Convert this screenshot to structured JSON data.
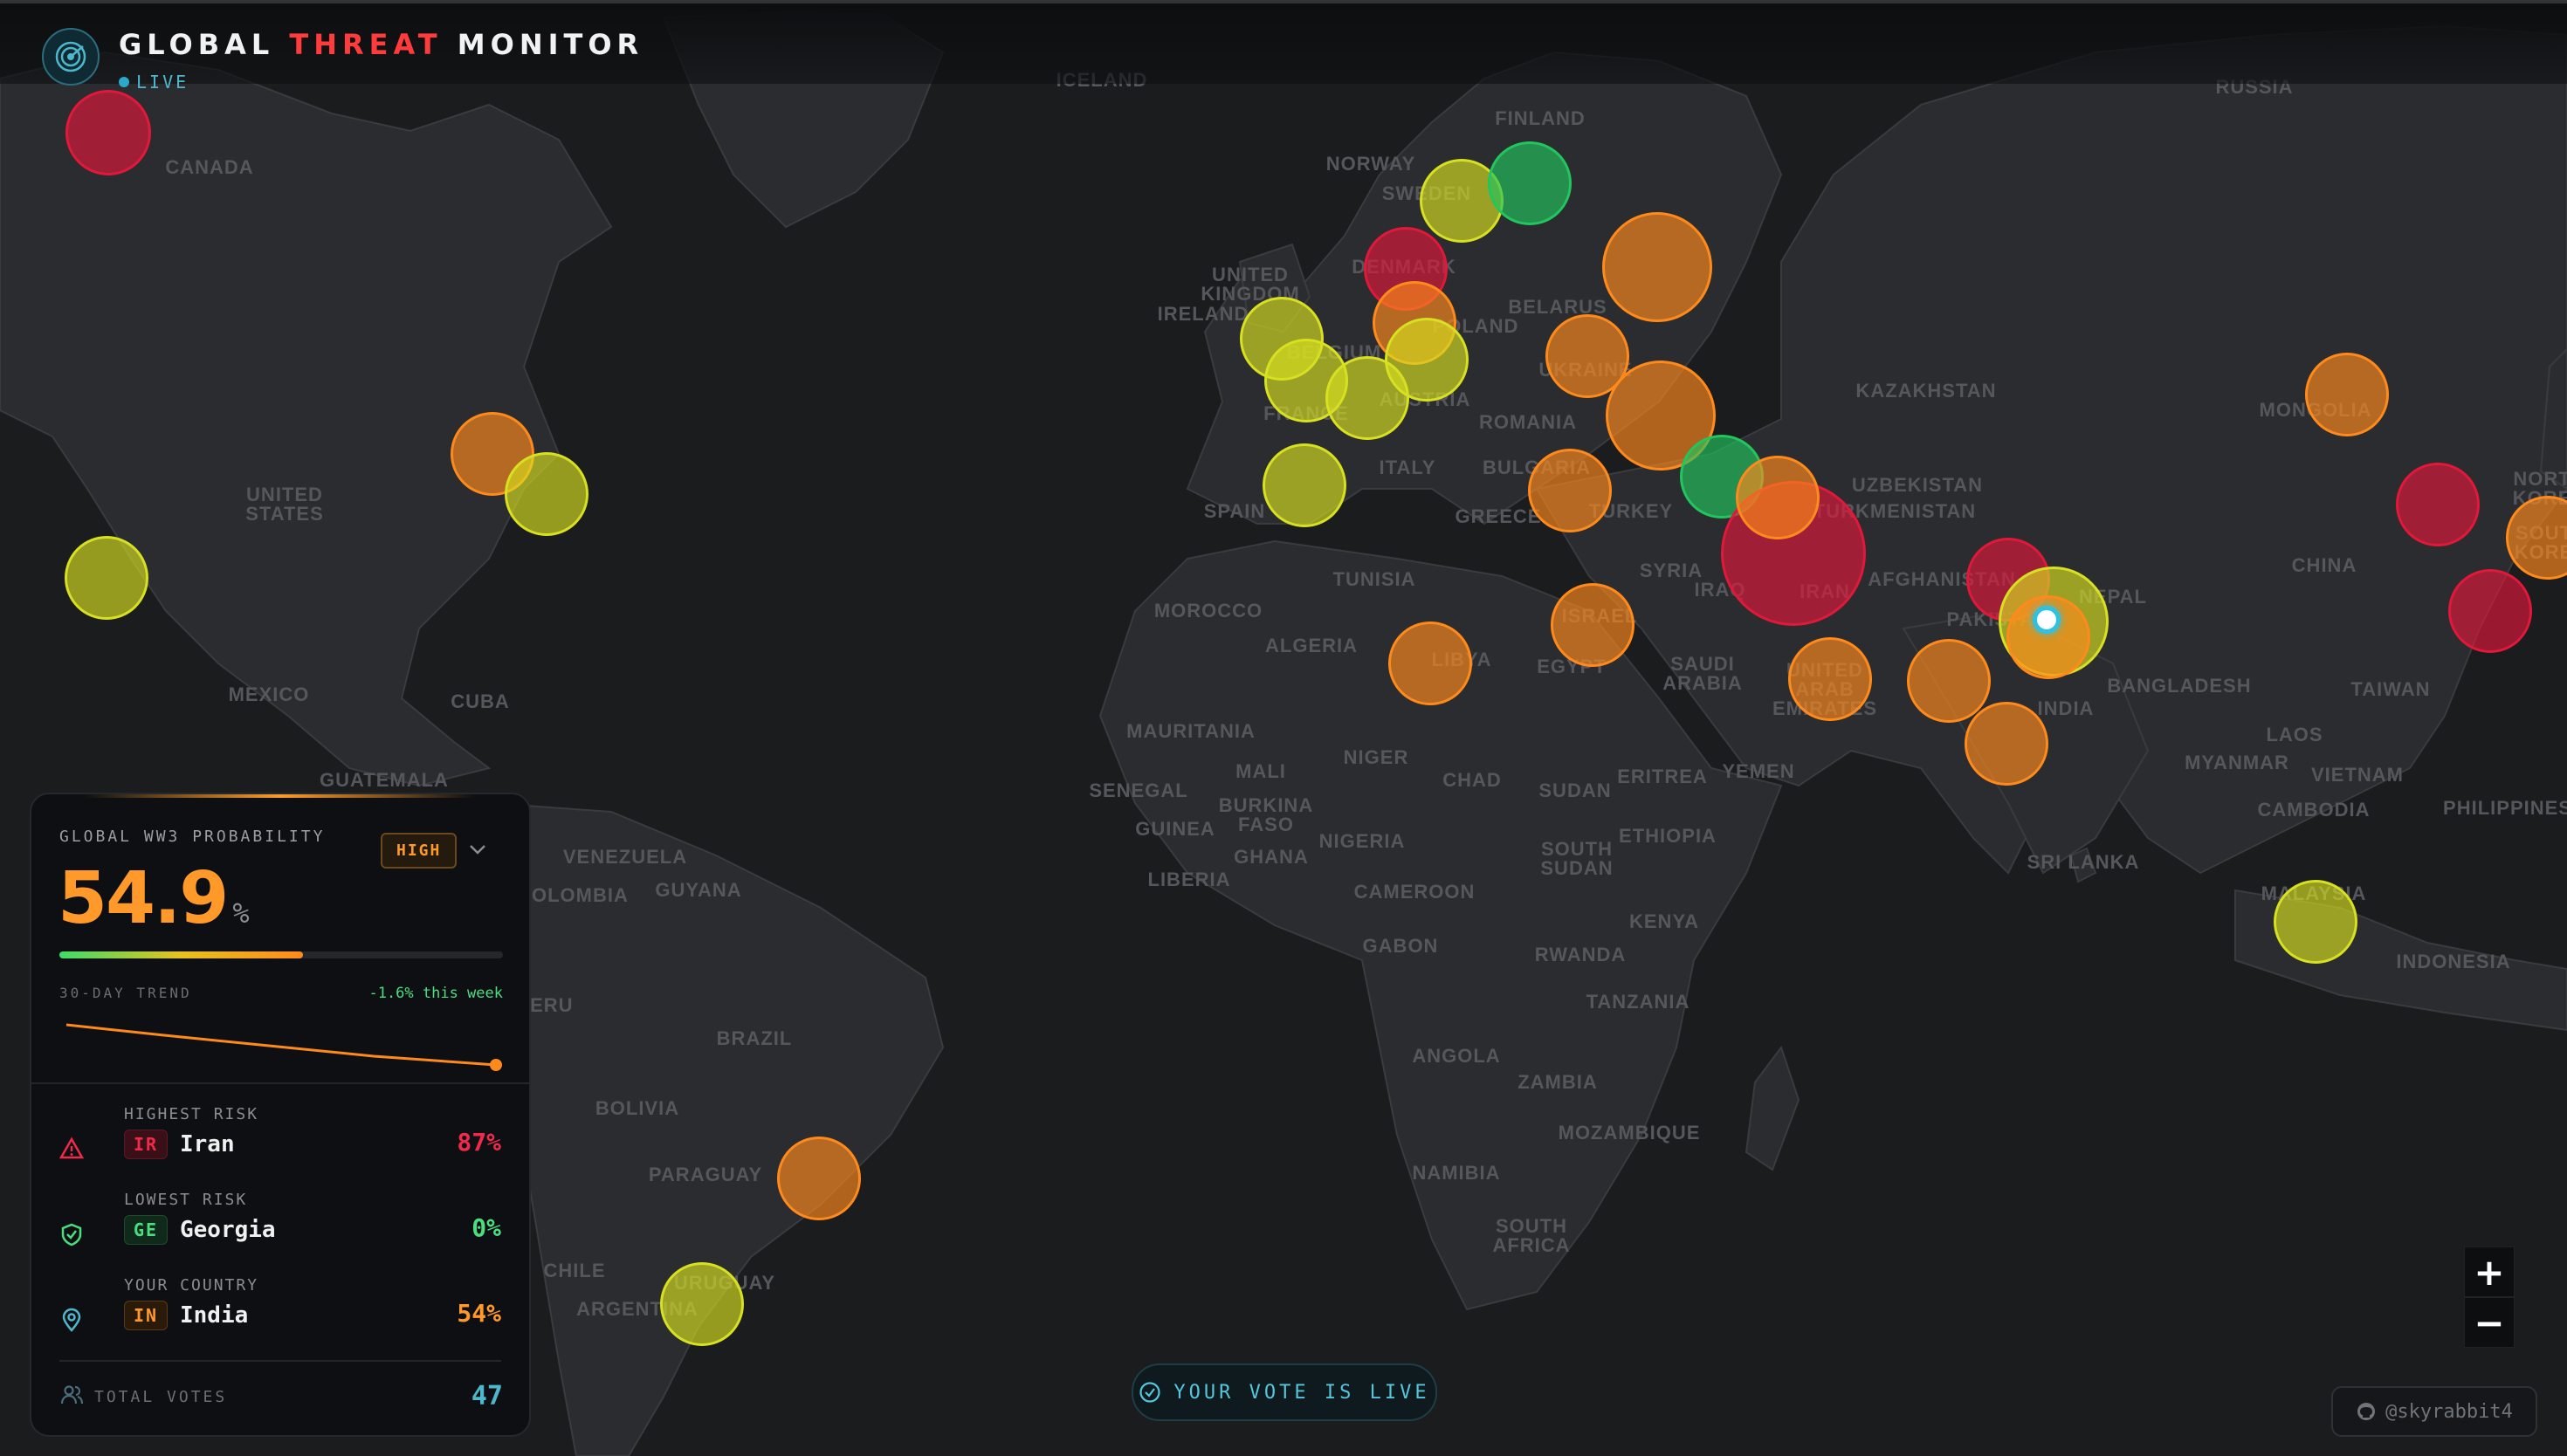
{
  "header": {
    "title_part1": "GLOBAL",
    "title_part2": "THREAT",
    "title_part3": "MONITOR",
    "live_label": "LIVE"
  },
  "map_labels": [
    {
      "text": "ICELAND",
      "id": "iceland"
    },
    {
      "text": "RUSSIA",
      "id": "russia"
    },
    {
      "text": "FINLAND",
      "id": "finland"
    },
    {
      "text": "NORWAY",
      "id": "norway"
    },
    {
      "text": "SWEDEN",
      "id": "sweden"
    },
    {
      "text": "CANADA",
      "id": "canada"
    },
    {
      "text": "UNITED\nKINGDOM",
      "id": "uk"
    },
    {
      "text": "IRELAND",
      "id": "ireland"
    },
    {
      "text": "DENMARK",
      "id": "denmark"
    },
    {
      "text": "BELARUS",
      "id": "belarus"
    },
    {
      "text": "POLAND",
      "id": "poland"
    },
    {
      "text": "BELGIUM",
      "id": "belgium"
    },
    {
      "text": "UKRAINE",
      "id": "ukraine"
    },
    {
      "text": "FRANCE",
      "id": "france"
    },
    {
      "text": "AUSTRIA",
      "id": "austria"
    },
    {
      "text": "ROMANIA",
      "id": "romania"
    },
    {
      "text": "KAZAKHSTAN",
      "id": "kazakhstan"
    },
    {
      "text": "MONGOLIA",
      "id": "mongolia"
    },
    {
      "text": "UNITED\nSTATES",
      "id": "usa"
    },
    {
      "text": "SPAIN",
      "id": "spain"
    },
    {
      "text": "ITALY",
      "id": "italy"
    },
    {
      "text": "BULGARIA",
      "id": "bulgaria"
    },
    {
      "text": "GREECE",
      "id": "greece"
    },
    {
      "text": "TURKEY",
      "id": "turkey"
    },
    {
      "text": "UZBEKISTAN",
      "id": "uzbekistan"
    },
    {
      "text": "TURKMENISTAN",
      "id": "turkmenistan"
    },
    {
      "text": "NORTH\nKOREA",
      "id": "north-korea"
    },
    {
      "text": "SOUTH\nKOREA",
      "id": "south-korea"
    },
    {
      "text": "SYRIA",
      "id": "syria"
    },
    {
      "text": "AFGHANISTAN",
      "id": "afghanistan"
    },
    {
      "text": "CHINA",
      "id": "china"
    },
    {
      "text": "TUNISIA",
      "id": "tunisia"
    },
    {
      "text": "IRAQ",
      "id": "iraq"
    },
    {
      "text": "IRAN",
      "id": "iran"
    },
    {
      "text": "MOROCCO",
      "id": "morocco"
    },
    {
      "text": "ISRAEL",
      "id": "israel"
    },
    {
      "text": "PAKISTAN",
      "id": "pakistan"
    },
    {
      "text": "NEPAL",
      "id": "nepal"
    },
    {
      "text": "MEXICO",
      "id": "mexico"
    },
    {
      "text": "CUBA",
      "id": "cuba"
    },
    {
      "text": "ALGERIA",
      "id": "algeria"
    },
    {
      "text": "LIBYA",
      "id": "libya"
    },
    {
      "text": "EGYPT",
      "id": "egypt"
    },
    {
      "text": "SAUDI\nARABIA",
      "id": "saudi"
    },
    {
      "text": "UNITED\nARAB\nEMIRATES",
      "id": "uae"
    },
    {
      "text": "BANGLADESH",
      "id": "bangladesh"
    },
    {
      "text": "INDIA",
      "id": "india"
    },
    {
      "text": "TAIWAN",
      "id": "taiwan"
    },
    {
      "text": "GUATEMALA",
      "id": "guatemala"
    },
    {
      "text": "MAURITANIA",
      "id": "mauritania"
    },
    {
      "text": "MALI",
      "id": "mali"
    },
    {
      "text": "NIGER",
      "id": "niger"
    },
    {
      "text": "CHAD",
      "id": "chad"
    },
    {
      "text": "SUDAN",
      "id": "sudan"
    },
    {
      "text": "ERITREA",
      "id": "eritrea"
    },
    {
      "text": "YEMEN",
      "id": "yemen"
    },
    {
      "text": "LAOS",
      "id": "laos"
    },
    {
      "text": "MYANMAR",
      "id": "myanmar"
    },
    {
      "text": "VIETNAM",
      "id": "vietnam"
    },
    {
      "text": "SENEGAL",
      "id": "senegal"
    },
    {
      "text": "BURKINA\nFASO",
      "id": "burkina"
    },
    {
      "text": "GUINEA",
      "id": "guinea"
    },
    {
      "text": "GHANA",
      "id": "ghana"
    },
    {
      "text": "NIGERIA",
      "id": "nigeria"
    },
    {
      "text": "ETHIOPIA",
      "id": "ethiopia"
    },
    {
      "text": "CAMBODIA",
      "id": "cambodia"
    },
    {
      "text": "PHILIPPINES",
      "id": "philippines"
    },
    {
      "text": "VENEZUELA",
      "id": "venezuela"
    },
    {
      "text": "GUYANA",
      "id": "guyana"
    },
    {
      "text": "COLOMBIA",
      "id": "colombia"
    },
    {
      "text": "SOUTH\nSUDAN",
      "id": "south-sudan"
    },
    {
      "text": "SRI LANKA",
      "id": "sri-lanka"
    },
    {
      "text": "LIBERIA",
      "id": "liberia"
    },
    {
      "text": "CAMEROON",
      "id": "cameroon"
    },
    {
      "text": "MALAYSIA",
      "id": "malaysia"
    },
    {
      "text": "GABON",
      "id": "gabon"
    },
    {
      "text": "KENYA",
      "id": "kenya"
    },
    {
      "text": "RWANDA",
      "id": "rwanda"
    },
    {
      "text": "INDONESIA",
      "id": "indonesia"
    },
    {
      "text": "PERU",
      "id": "peru"
    },
    {
      "text": "TANZANIA",
      "id": "tanzania"
    },
    {
      "text": "BRAZIL",
      "id": "brazil"
    },
    {
      "text": "ANGOLA",
      "id": "angola"
    },
    {
      "text": "ZAMBIA",
      "id": "zambia"
    },
    {
      "text": "BOLIVIA",
      "id": "bolivia"
    },
    {
      "text": "MOZAMBIQUE",
      "id": "mozambique"
    },
    {
      "text": "NAMIBIA",
      "id": "namibia"
    },
    {
      "text": "PARAGUAY",
      "id": "paraguay"
    },
    {
      "text": "SOUTH\nAFRICA",
      "id": "south-africa"
    },
    {
      "text": "CHILE",
      "id": "chile"
    },
    {
      "text": "URUGUAY",
      "id": "uruguay"
    },
    {
      "text": "ARGENTINA",
      "id": "argentina"
    }
  ],
  "risk_colors": {
    "red": "#e0183a",
    "orange": "#ff8a1c",
    "yellow": "#d7e021",
    "green": "#22c55e",
    "cyan": "#2ec2e0"
  },
  "markers": [
    {
      "id": "canada",
      "level": "red"
    },
    {
      "id": "usa-ne",
      "level": "orange"
    },
    {
      "id": "usa-e",
      "level": "yellow"
    },
    {
      "id": "usa-w",
      "level": "yellow"
    },
    {
      "id": "brazil",
      "level": "orange"
    },
    {
      "id": "uruguay",
      "level": "yellow"
    },
    {
      "id": "sweden",
      "level": "yellow"
    },
    {
      "id": "finland",
      "level": "green"
    },
    {
      "id": "denmark",
      "level": "red"
    },
    {
      "id": "germany",
      "level": "orange"
    },
    {
      "id": "uk",
      "level": "yellow"
    },
    {
      "id": "france",
      "level": "yellow"
    },
    {
      "id": "switzerland",
      "level": "yellow"
    },
    {
      "id": "poland",
      "level": "yellow"
    },
    {
      "id": "russia-w",
      "level": "orange"
    },
    {
      "id": "ukraine",
      "level": "orange"
    },
    {
      "id": "russia-s",
      "level": "orange"
    },
    {
      "id": "spain",
      "level": "yellow"
    },
    {
      "id": "greece",
      "level": "orange"
    },
    {
      "id": "georgia",
      "level": "green"
    },
    {
      "id": "iran",
      "level": "red"
    },
    {
      "id": "iran-n",
      "level": "orange"
    },
    {
      "id": "israel",
      "level": "orange"
    },
    {
      "id": "libya",
      "level": "orange"
    },
    {
      "id": "uae",
      "level": "orange"
    },
    {
      "id": "pakistan-s",
      "level": "orange"
    },
    {
      "id": "india-w",
      "level": "orange"
    },
    {
      "id": "afghanistan",
      "level": "red"
    },
    {
      "id": "india-n",
      "level": "yellow"
    },
    {
      "id": "india",
      "level": "orange"
    },
    {
      "id": "mongolia",
      "level": "orange"
    },
    {
      "id": "china-ne",
      "level": "red"
    },
    {
      "id": "korea",
      "level": "orange"
    },
    {
      "id": "china-e",
      "level": "red"
    },
    {
      "id": "malaysia",
      "level": "yellow"
    }
  ],
  "panel": {
    "title": "GLOBAL WW3 PROBABILITY",
    "badge": "HIGH",
    "probability": "54.9",
    "percent_sign": "%",
    "progress_fraction": 0.549,
    "trend_label": "30-DAY TREND",
    "trend_change": "-1.6% this week",
    "highest": {
      "caption": "HIGHEST RISK",
      "code": "IR",
      "name": "Iran",
      "pct": "87%"
    },
    "lowest": {
      "caption": "LOWEST RISK",
      "code": "GE",
      "name": "Georgia",
      "pct": "0%"
    },
    "yours": {
      "caption": "YOUR COUNTRY",
      "code": "IN",
      "name": "India",
      "pct": "54%"
    },
    "votes_label": "TOTAL VOTES",
    "votes_value": "47"
  },
  "vote_pill": "YOUR VOTE IS LIVE",
  "zoom": {
    "in": "+",
    "out": "−"
  },
  "github": "@skyrabbit4"
}
